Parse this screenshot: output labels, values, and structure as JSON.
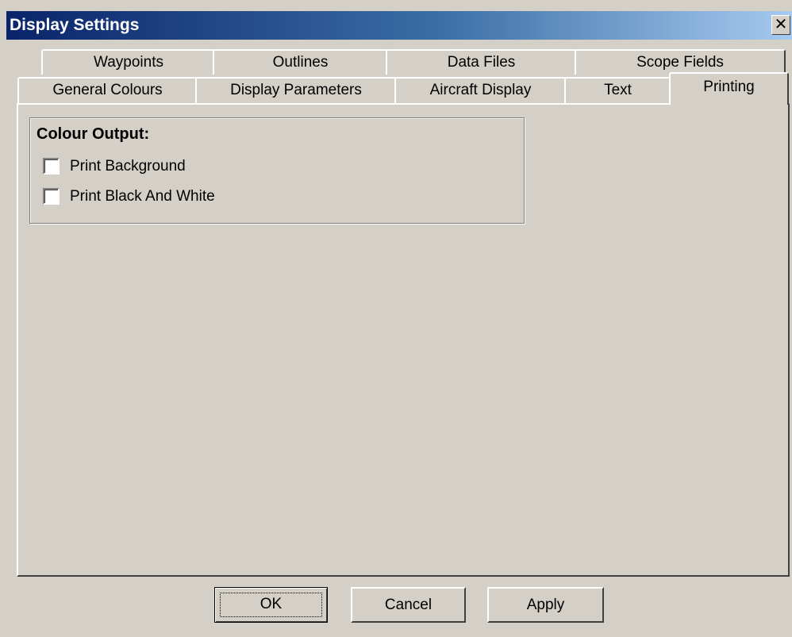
{
  "window": {
    "title": "Display Settings",
    "close_glyph": "✕"
  },
  "tabs": {
    "row1": [
      {
        "label": "Waypoints"
      },
      {
        "label": "Outlines"
      },
      {
        "label": "Data Files"
      },
      {
        "label": "Scope Fields"
      }
    ],
    "row2": [
      {
        "label": "General Colours"
      },
      {
        "label": "Display Parameters"
      },
      {
        "label": "Aircraft Display"
      },
      {
        "label": "Text"
      },
      {
        "label": "Printing",
        "active": true
      }
    ]
  },
  "printing": {
    "group_title": "Colour Output:",
    "options": [
      {
        "label": "Print Background",
        "checked": false
      },
      {
        "label": "Print Black And White",
        "checked": false
      }
    ]
  },
  "buttons": {
    "ok": "OK",
    "cancel": "Cancel",
    "apply": "Apply"
  },
  "colors": {
    "title_gradient_start": "#0a246a",
    "title_gradient_end": "#a6caf0",
    "face": "#d4d0c8"
  }
}
